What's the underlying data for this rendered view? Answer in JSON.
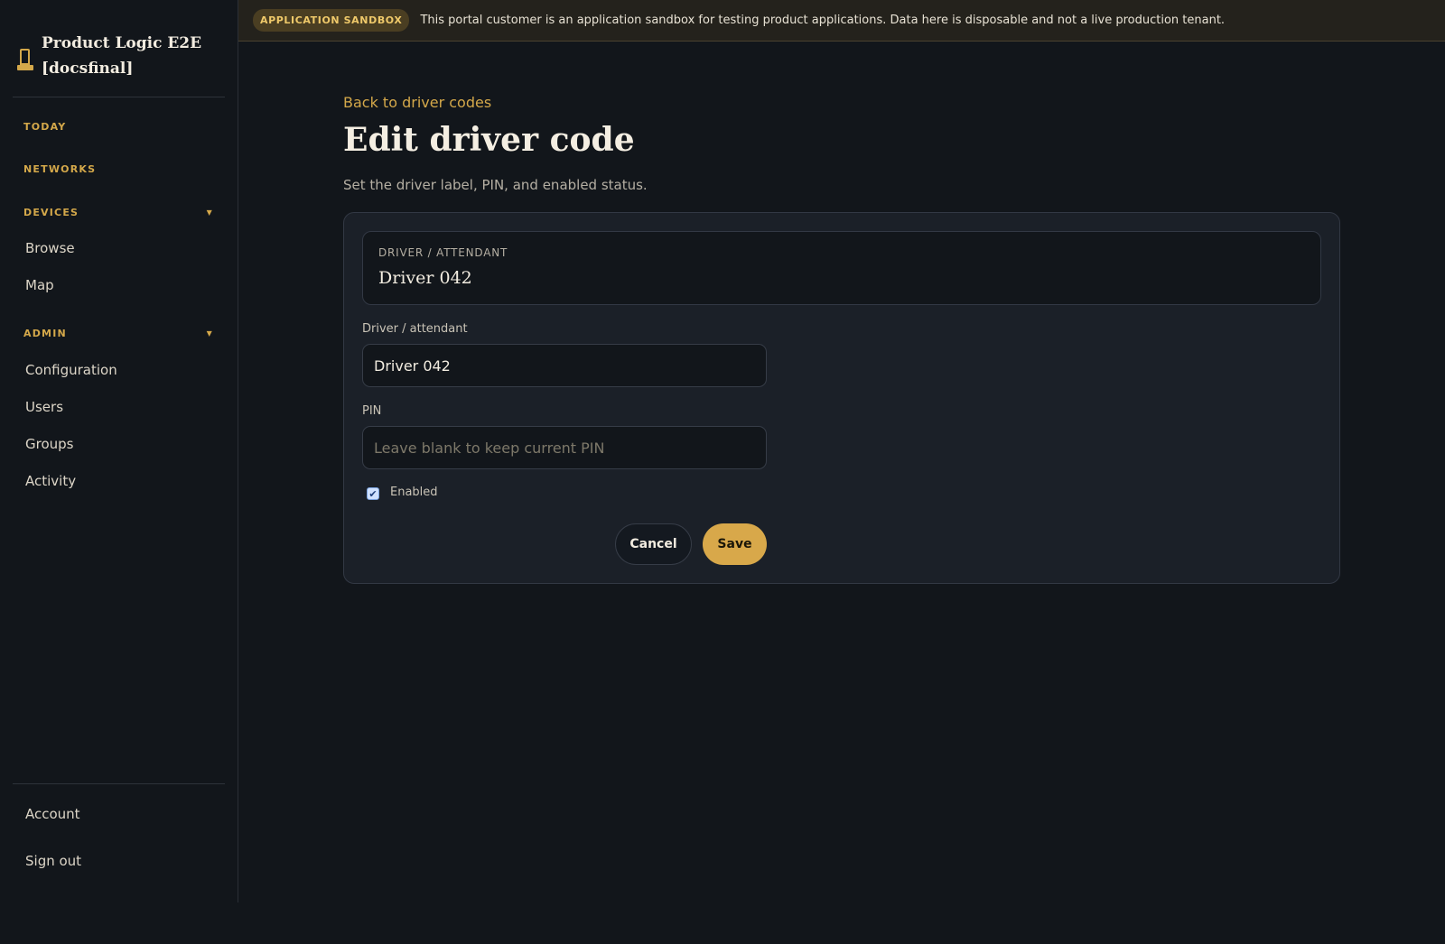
{
  "app": {
    "title": "Product Logic E2E [docsfinal]"
  },
  "banner": {
    "badge": "APPLICATION SANDBOX",
    "text": "This portal customer is an application sandbox for testing product applications. Data here is disposable and not a live production tenant."
  },
  "sidebar": {
    "today": "TODAY",
    "networks": "NETWORKS",
    "devices": {
      "label": "DEVICES",
      "items": [
        "Browse",
        "Map"
      ]
    },
    "admin": {
      "label": "ADMIN",
      "items": [
        "Configuration",
        "Users",
        "Groups",
        "Activity"
      ]
    },
    "footer": [
      "Account",
      "Sign out"
    ]
  },
  "page": {
    "back_link": "Back to driver codes",
    "title": "Edit driver code",
    "subtitle": "Set the driver label, PIN, and enabled status."
  },
  "form": {
    "summary_label": "DRIVER / ATTENDANT",
    "summary_value": "Driver 042",
    "driver_label": "Driver / attendant",
    "driver_value": "Driver 042",
    "pin_label": "PIN",
    "pin_placeholder": "Leave blank to keep current PIN",
    "enabled_label": "Enabled",
    "enabled": true,
    "cancel": "Cancel",
    "save": "Save"
  },
  "colors": {
    "accent": "#d4a84a",
    "background": "#12161b",
    "card": "#1b2028"
  }
}
